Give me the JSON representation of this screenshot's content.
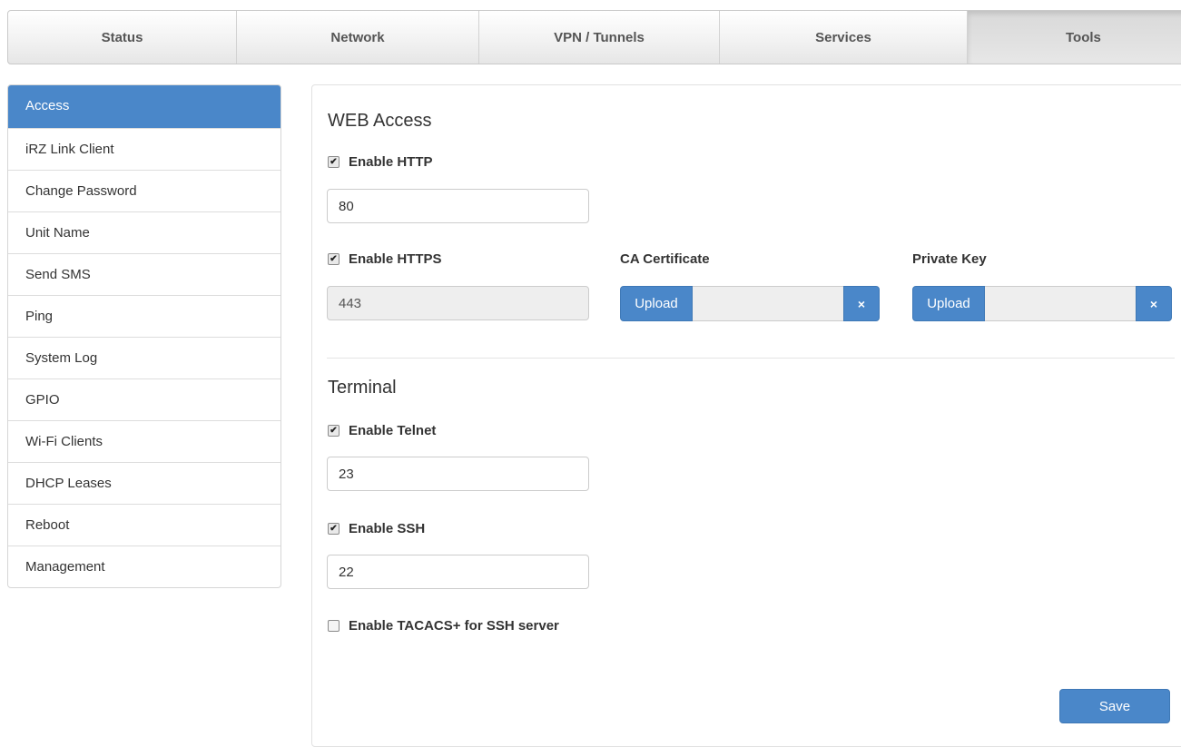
{
  "nav": {
    "tabs": [
      {
        "label": "Status"
      },
      {
        "label": "Network"
      },
      {
        "label": "VPN / Tunnels"
      },
      {
        "label": "Services"
      },
      {
        "label": "Tools"
      }
    ],
    "active": "Tools"
  },
  "sidebar": {
    "items": [
      {
        "label": "Access"
      },
      {
        "label": "iRZ Link Client"
      },
      {
        "label": "Change Password"
      },
      {
        "label": "Unit Name"
      },
      {
        "label": "Send SMS"
      },
      {
        "label": "Ping"
      },
      {
        "label": "System Log"
      },
      {
        "label": "GPIO"
      },
      {
        "label": "Wi-Fi Clients"
      },
      {
        "label": "DHCP Leases"
      },
      {
        "label": "Reboot"
      },
      {
        "label": "Management"
      }
    ],
    "active": "Access"
  },
  "web_access": {
    "title": "WEB Access",
    "http": {
      "label": "Enable HTTP",
      "checked": true,
      "port": "80"
    },
    "https": {
      "label": "Enable HTTPS",
      "checked": true,
      "port": "443"
    },
    "ca_certificate": {
      "label": "CA Certificate",
      "upload_label": "Upload",
      "clear_label": "×"
    },
    "private_key": {
      "label": "Private Key",
      "upload_label": "Upload",
      "clear_label": "×"
    }
  },
  "terminal": {
    "title": "Terminal",
    "telnet": {
      "label": "Enable Telnet",
      "checked": true,
      "port": "23"
    },
    "ssh": {
      "label": "Enable SSH",
      "checked": true,
      "port": "22"
    },
    "tacacs": {
      "label": "Enable TACACS+ for SSH server",
      "checked": false
    }
  },
  "save_label": "Save",
  "colors": {
    "accent": "#4a87c9"
  }
}
